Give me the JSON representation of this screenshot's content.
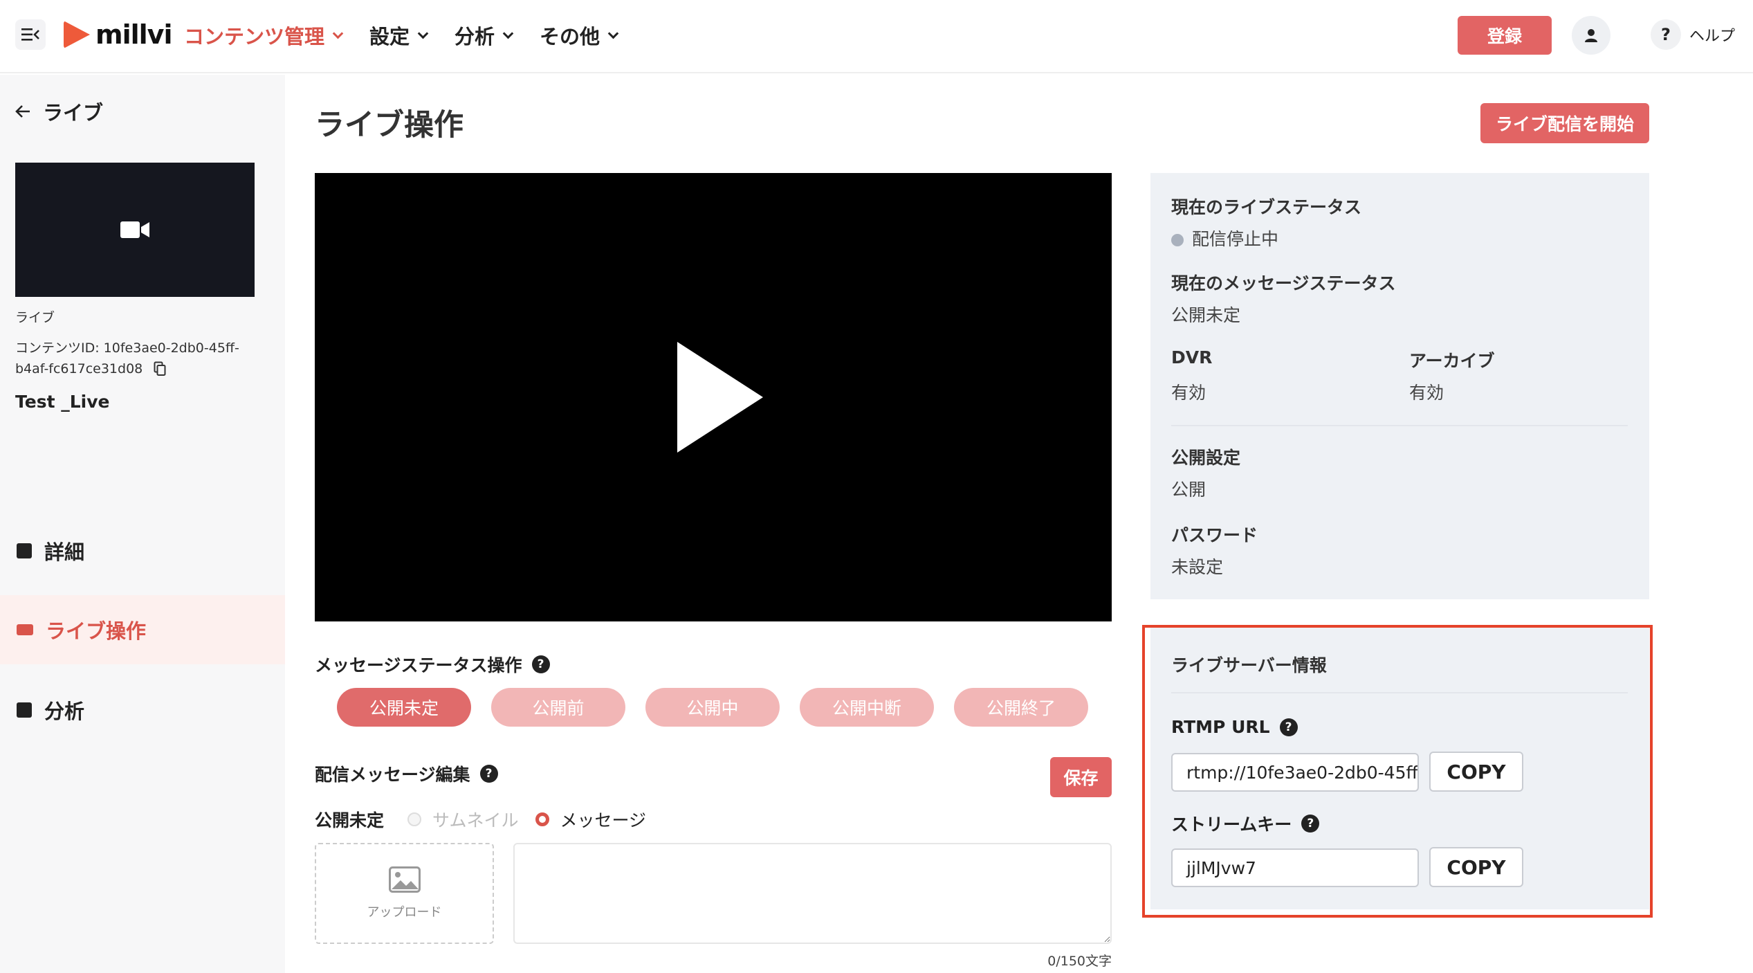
{
  "header": {
    "logo": "millvi",
    "nav": [
      {
        "label": "コンテンツ管理"
      },
      {
        "label": "設定"
      },
      {
        "label": "分析"
      },
      {
        "label": "その他"
      }
    ],
    "register_label": "登録",
    "help_label": "ヘルプ",
    "help_symbol": "?"
  },
  "sidebar": {
    "back_label": "ライブ",
    "content_kind": "ライブ",
    "content_id": "コンテンツID: 10fe3ae0-2db0-45ff-b4af-fc617ce31d08",
    "content_title": "Test _Live",
    "items": [
      {
        "label": "詳細"
      },
      {
        "label": "ライブ操作"
      },
      {
        "label": "分析"
      }
    ]
  },
  "main": {
    "title": "ライブ操作",
    "start_button": "ライブ配信を開始",
    "message_status_label": "メッセージステータス操作",
    "status_pills": [
      "公開未定",
      "公開前",
      "公開中",
      "公開中断",
      "公開終了"
    ],
    "message_edit_label": "配信メッセージ編集",
    "save_label": "保存",
    "current_status": "公開未定",
    "radio_thumbnail": "サムネイル",
    "radio_message": "メッセージ",
    "upload_label": "アップロード",
    "counter": "0/150文字"
  },
  "status_panel": {
    "live_status_heading": "現在のライブステータス",
    "live_status_value": "配信停止中",
    "message_status_heading": "現在のメッセージステータス",
    "message_status_value": "公開未定",
    "dvr_heading": "DVR",
    "dvr_value": "有効",
    "archive_heading": "アーカイブ",
    "archive_value": "有効",
    "visibility_heading": "公開設定",
    "visibility_value": "公開",
    "password_heading": "パスワード",
    "password_value": "未設定"
  },
  "server_panel": {
    "heading": "ライブサーバー情報",
    "rtmp_label": "RTMP URL",
    "rtmp_value": "rtmp://10fe3ae0-2db0-45ff",
    "stream_key_label": "ストリームキー",
    "stream_key_value": "jjlMJvw7",
    "copy_label": "COPY"
  },
  "colors": {
    "accent": "#e26464",
    "highlight_border": "#e5432b"
  }
}
